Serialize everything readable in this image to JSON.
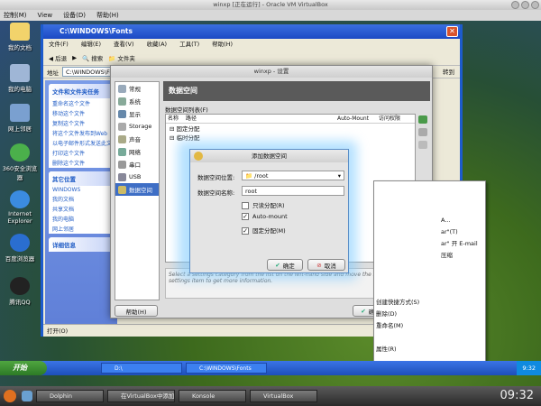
{
  "vbox": {
    "title": "winxp [正在运行] - Oracle VM VirtualBox",
    "menu": [
      "控制(M)",
      "View",
      "设备(D)",
      "帮助(H)"
    ]
  },
  "desktop": {
    "icons": [
      "我的文档",
      "我的电脑",
      "网上邻居",
      "360安全浏览器",
      "Internet Explorer",
      "百度浏览器",
      "腾讯QQ"
    ]
  },
  "explorer": {
    "title": "C:\\WINDOWS\\Fonts",
    "menu": [
      "文件(F)",
      "编辑(E)",
      "查看(V)",
      "收藏(A)",
      "工具(T)",
      "帮助(H)"
    ],
    "toolbar": {
      "back": "后退",
      "search": "搜索",
      "folders": "文件夹"
    },
    "address": "C:\\WINDOWS\\Fonts",
    "go": "转到",
    "panel1": {
      "title": "文件和文件夹任务",
      "items": [
        "重命名这个文件",
        "移动这个文件",
        "复制这个文件",
        "将这个文件发布到Web",
        "以电子邮件形式发送此文件",
        "打印这个文件",
        "删除这个文件"
      ]
    },
    "panel2": {
      "title": "其它位置",
      "items": [
        "WINDOWS",
        "我的文档",
        "共享文档",
        "我的电脑",
        "网上邻居"
      ]
    },
    "panel3": {
      "title": "详细信息"
    },
    "status": "打开(O)"
  },
  "settings": {
    "title": "winxp - 设置",
    "nav": [
      "常规",
      "系统",
      "显示",
      "Storage",
      "声音",
      "网络",
      "串口",
      "USB",
      "数据空间"
    ],
    "heading": "数据空间",
    "list_label": "数据空间列表(F)",
    "columns": [
      "名称",
      "路径",
      "Auto-Mount",
      "访问权限"
    ],
    "rows": [
      "固定分配",
      "临时分配"
    ],
    "info": "Select a settings category from the list on the left-hand side and move the mouse over a settings item to get more information.",
    "help": "帮助(H)",
    "ok": "确定",
    "cancel": "取消"
  },
  "share": {
    "title": "添加数据空间",
    "path_label": "数据空间位置:",
    "path_value": "/root",
    "name_label": "数据空间名称:",
    "name_value": "root",
    "readonly": "只读分配(R)",
    "automount": "Auto-mount",
    "permanent": "固定分配(M)",
    "readonly_checked": false,
    "automount_checked": true,
    "permanent_checked": true,
    "ok": "确定",
    "cancel": "取消"
  },
  "ctx": {
    "items": [
      "A...",
      "ar\"(T)",
      "ar\" 开 E-mail",
      "压缩",
      "",
      "",
      " ",
      "创建快捷方式(S)",
      "删除(D)",
      "重命名(M)",
      "",
      "属性(R)"
    ]
  },
  "xp_taskbar": {
    "start": "开始",
    "tasks": [
      "D:\\",
      "C:\\WINDOWS\\Fonts"
    ],
    "time": "9:32"
  },
  "host": {
    "tasks": [
      "Dolphin",
      "在VirtualBox中添加共...",
      "Konsole",
      "VirtualBox"
    ],
    "clock": "09:32"
  }
}
